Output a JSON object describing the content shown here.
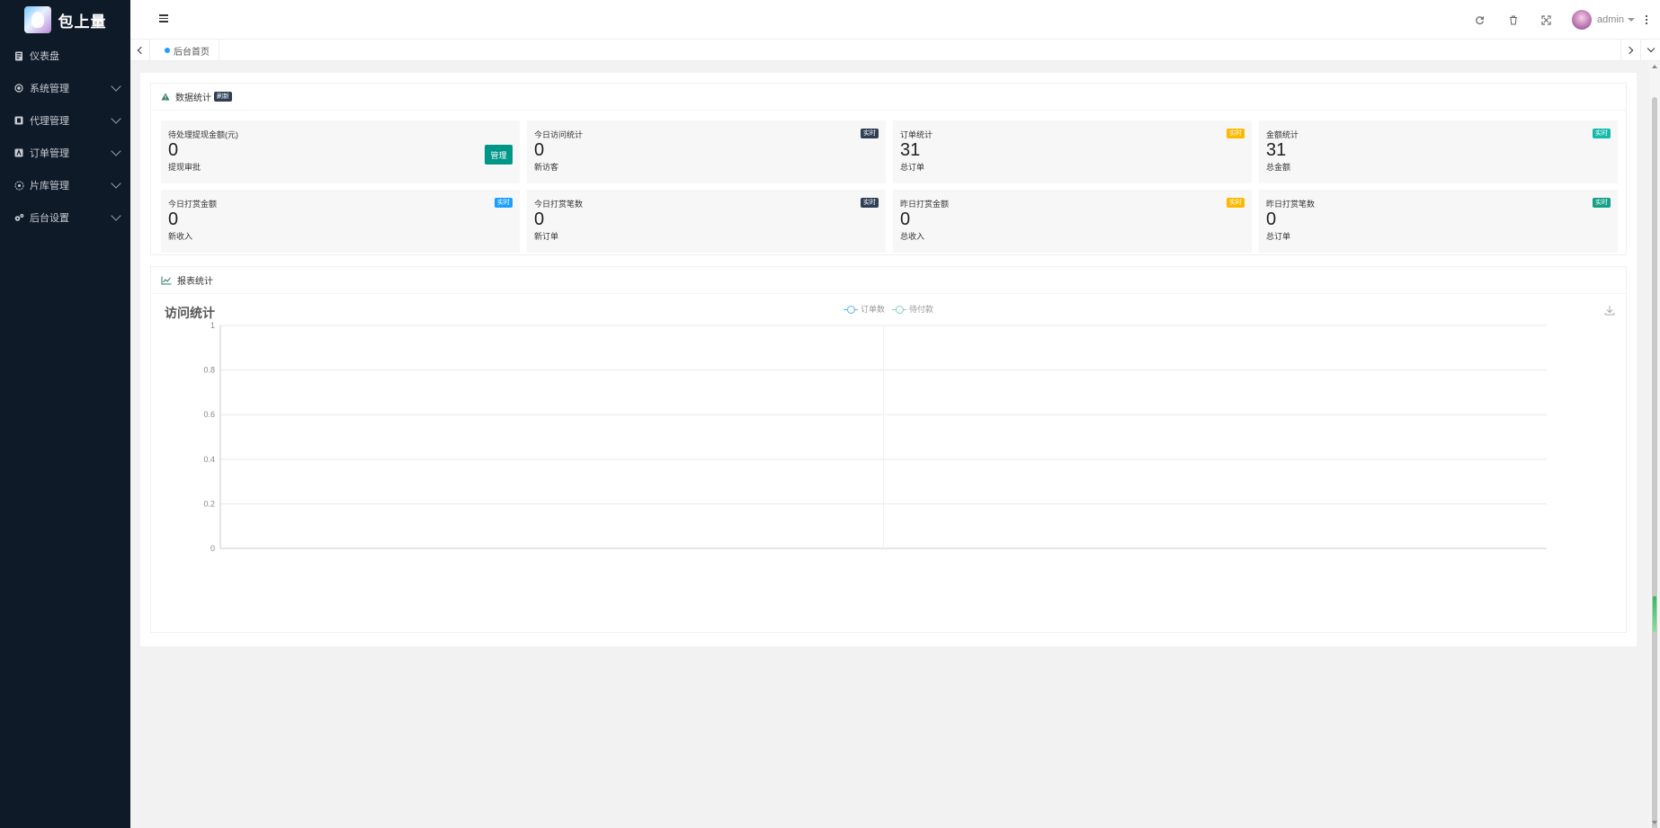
{
  "brand": {
    "name": "包上量"
  },
  "sidebar": {
    "items": [
      {
        "label": "仪表盘",
        "icon": "dashboard-icon",
        "has_children": false
      },
      {
        "label": "系统管理",
        "icon": "settings-circle-icon",
        "has_children": true
      },
      {
        "label": "代理管理",
        "icon": "agent-icon",
        "has_children": true
      },
      {
        "label": "订单管理",
        "icon": "order-icon",
        "has_children": true
      },
      {
        "label": "片库管理",
        "icon": "library-icon",
        "has_children": true
      },
      {
        "label": "后台设置",
        "icon": "gears-icon",
        "has_children": true
      }
    ]
  },
  "header": {
    "icons": [
      "refresh-icon",
      "trash-icon",
      "fullscreen-icon"
    ],
    "user": {
      "name": "admin"
    }
  },
  "tabs": [
    {
      "label": "后台首页",
      "active": true
    }
  ],
  "stats_card": {
    "title": "数据统计",
    "badge": "刷新",
    "stats": [
      {
        "title": "待处理提现金额(元)",
        "value": "0",
        "sub": "提现审批",
        "button": "管理"
      },
      {
        "title": "今日访问统计",
        "value": "0",
        "sub": "新访客",
        "badge": "实时",
        "badge_color": "dark"
      },
      {
        "title": "订单统计",
        "value": "31",
        "sub": "总订单",
        "badge": "实时",
        "badge_color": "orange"
      },
      {
        "title": "金额统计",
        "value": "31",
        "sub": "总金额",
        "badge": "实时",
        "badge_color": "green"
      },
      {
        "title": "今日打赏金额",
        "value": "0",
        "sub": "新收入",
        "badge": "实时",
        "badge_color": "blue"
      },
      {
        "title": "今日打赏笔数",
        "value": "0",
        "sub": "新订单",
        "badge": "实时",
        "badge_color": "dark"
      },
      {
        "title": "昨日打赏金额",
        "value": "0",
        "sub": "总收入",
        "badge": "实时",
        "badge_color": "orange"
      },
      {
        "title": "昨日打赏笔数",
        "value": "0",
        "sub": "总订单",
        "badge": "实时",
        "badge_color": "green2"
      }
    ]
  },
  "report_card": {
    "title": "报表统计"
  },
  "chart_data": {
    "type": "line",
    "title": "访问统计",
    "series": [
      {
        "name": "订单数",
        "values": [],
        "color": "#5ab1ef"
      },
      {
        "name": "待付款",
        "values": [],
        "color": "#7fd3c2"
      }
    ],
    "y_ticks": [
      "0",
      "0.2",
      "0.4",
      "0.6",
      "0.8",
      "1"
    ],
    "ylim": [
      0,
      1
    ],
    "grid": true,
    "legend_position": "top-center"
  },
  "colors": {
    "sidebar_bg": "#0f1a29",
    "primary": "#009688",
    "tab_dot": "#1e9fff"
  }
}
